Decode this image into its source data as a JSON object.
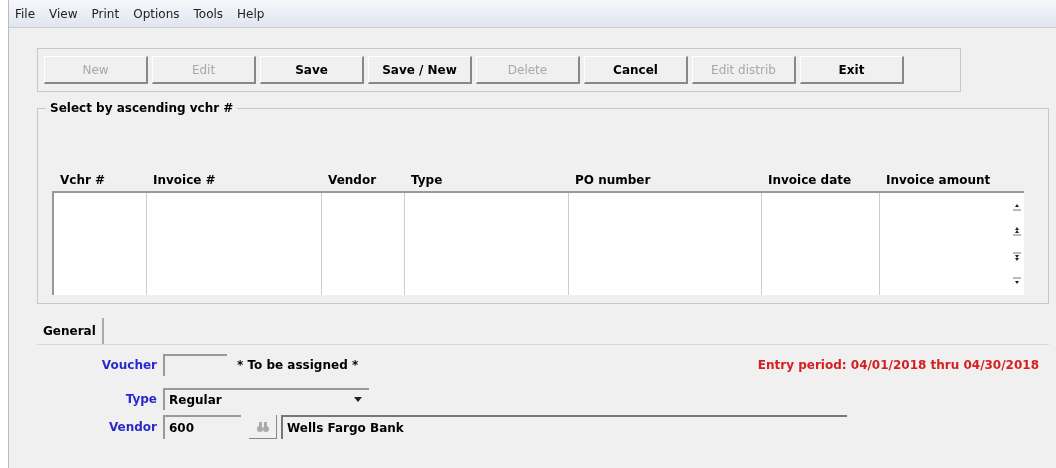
{
  "menu": [
    "File",
    "View",
    "Print",
    "Options",
    "Tools",
    "Help"
  ],
  "toolbar": [
    {
      "label": "New",
      "disabled": true
    },
    {
      "label": "Edit",
      "disabled": true
    },
    {
      "label": "Save",
      "disabled": false
    },
    {
      "label": "Save / New",
      "disabled": false
    },
    {
      "label": "Delete",
      "disabled": true
    },
    {
      "label": "Cancel",
      "disabled": false
    },
    {
      "label": "Edit distrib",
      "disabled": true
    },
    {
      "label": "Exit",
      "disabled": false
    }
  ],
  "list": {
    "title": "Select by ascending vchr #",
    "columns": [
      "Vchr #",
      "Invoice #",
      "Vendor",
      "Type",
      "PO number",
      "Invoice date",
      "Invoice amount"
    ]
  },
  "tabs": [
    {
      "label": "General",
      "selected": true
    }
  ],
  "form": {
    "voucher": {
      "label": "Voucher",
      "note": "* To be assigned *"
    },
    "type": {
      "label": "Type",
      "value": "Regular"
    },
    "vendor": {
      "label": "Vendor",
      "value": "600",
      "name": "Wells Fargo Bank"
    },
    "entry_period": "Entry period: 04/01/2018 thru 04/30/2018"
  }
}
